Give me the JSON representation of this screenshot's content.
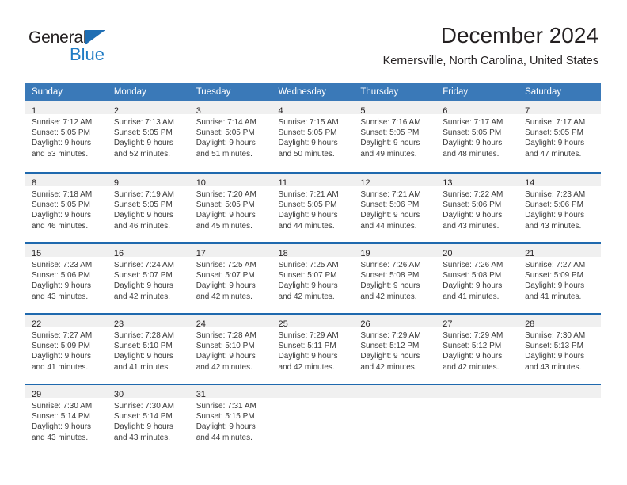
{
  "brand": {
    "name_part1": "General",
    "name_part2": "Blue",
    "triangle_icon": "triangle-icon"
  },
  "header": {
    "title": "December 2024",
    "subtitle": "Kernersville, North Carolina, United States"
  },
  "calendar": {
    "weekday_headers": [
      "Sunday",
      "Monday",
      "Tuesday",
      "Wednesday",
      "Thursday",
      "Friday",
      "Saturday"
    ],
    "colors": {
      "header_background": "#3a79b8",
      "header_text": "#ffffff",
      "row_separator": "#1f69ae",
      "daynum_strip": "#f0f0f0",
      "brand_blue": "#1f7bc4"
    },
    "weeks": [
      [
        {
          "day": "1",
          "sunrise": "Sunrise: 7:12 AM",
          "sunset": "Sunset: 5:05 PM",
          "daylight1": "Daylight: 9 hours",
          "daylight2": "and 53 minutes."
        },
        {
          "day": "2",
          "sunrise": "Sunrise: 7:13 AM",
          "sunset": "Sunset: 5:05 PM",
          "daylight1": "Daylight: 9 hours",
          "daylight2": "and 52 minutes."
        },
        {
          "day": "3",
          "sunrise": "Sunrise: 7:14 AM",
          "sunset": "Sunset: 5:05 PM",
          "daylight1": "Daylight: 9 hours",
          "daylight2": "and 51 minutes."
        },
        {
          "day": "4",
          "sunrise": "Sunrise: 7:15 AM",
          "sunset": "Sunset: 5:05 PM",
          "daylight1": "Daylight: 9 hours",
          "daylight2": "and 50 minutes."
        },
        {
          "day": "5",
          "sunrise": "Sunrise: 7:16 AM",
          "sunset": "Sunset: 5:05 PM",
          "daylight1": "Daylight: 9 hours",
          "daylight2": "and 49 minutes."
        },
        {
          "day": "6",
          "sunrise": "Sunrise: 7:17 AM",
          "sunset": "Sunset: 5:05 PM",
          "daylight1": "Daylight: 9 hours",
          "daylight2": "and 48 minutes."
        },
        {
          "day": "7",
          "sunrise": "Sunrise: 7:17 AM",
          "sunset": "Sunset: 5:05 PM",
          "daylight1": "Daylight: 9 hours",
          "daylight2": "and 47 minutes."
        }
      ],
      [
        {
          "day": "8",
          "sunrise": "Sunrise: 7:18 AM",
          "sunset": "Sunset: 5:05 PM",
          "daylight1": "Daylight: 9 hours",
          "daylight2": "and 46 minutes."
        },
        {
          "day": "9",
          "sunrise": "Sunrise: 7:19 AM",
          "sunset": "Sunset: 5:05 PM",
          "daylight1": "Daylight: 9 hours",
          "daylight2": "and 46 minutes."
        },
        {
          "day": "10",
          "sunrise": "Sunrise: 7:20 AM",
          "sunset": "Sunset: 5:05 PM",
          "daylight1": "Daylight: 9 hours",
          "daylight2": "and 45 minutes."
        },
        {
          "day": "11",
          "sunrise": "Sunrise: 7:21 AM",
          "sunset": "Sunset: 5:05 PM",
          "daylight1": "Daylight: 9 hours",
          "daylight2": "and 44 minutes."
        },
        {
          "day": "12",
          "sunrise": "Sunrise: 7:21 AM",
          "sunset": "Sunset: 5:06 PM",
          "daylight1": "Daylight: 9 hours",
          "daylight2": "and 44 minutes."
        },
        {
          "day": "13",
          "sunrise": "Sunrise: 7:22 AM",
          "sunset": "Sunset: 5:06 PM",
          "daylight1": "Daylight: 9 hours",
          "daylight2": "and 43 minutes."
        },
        {
          "day": "14",
          "sunrise": "Sunrise: 7:23 AM",
          "sunset": "Sunset: 5:06 PM",
          "daylight1": "Daylight: 9 hours",
          "daylight2": "and 43 minutes."
        }
      ],
      [
        {
          "day": "15",
          "sunrise": "Sunrise: 7:23 AM",
          "sunset": "Sunset: 5:06 PM",
          "daylight1": "Daylight: 9 hours",
          "daylight2": "and 43 minutes."
        },
        {
          "day": "16",
          "sunrise": "Sunrise: 7:24 AM",
          "sunset": "Sunset: 5:07 PM",
          "daylight1": "Daylight: 9 hours",
          "daylight2": "and 42 minutes."
        },
        {
          "day": "17",
          "sunrise": "Sunrise: 7:25 AM",
          "sunset": "Sunset: 5:07 PM",
          "daylight1": "Daylight: 9 hours",
          "daylight2": "and 42 minutes."
        },
        {
          "day": "18",
          "sunrise": "Sunrise: 7:25 AM",
          "sunset": "Sunset: 5:07 PM",
          "daylight1": "Daylight: 9 hours",
          "daylight2": "and 42 minutes."
        },
        {
          "day": "19",
          "sunrise": "Sunrise: 7:26 AM",
          "sunset": "Sunset: 5:08 PM",
          "daylight1": "Daylight: 9 hours",
          "daylight2": "and 42 minutes."
        },
        {
          "day": "20",
          "sunrise": "Sunrise: 7:26 AM",
          "sunset": "Sunset: 5:08 PM",
          "daylight1": "Daylight: 9 hours",
          "daylight2": "and 41 minutes."
        },
        {
          "day": "21",
          "sunrise": "Sunrise: 7:27 AM",
          "sunset": "Sunset: 5:09 PM",
          "daylight1": "Daylight: 9 hours",
          "daylight2": "and 41 minutes."
        }
      ],
      [
        {
          "day": "22",
          "sunrise": "Sunrise: 7:27 AM",
          "sunset": "Sunset: 5:09 PM",
          "daylight1": "Daylight: 9 hours",
          "daylight2": "and 41 minutes."
        },
        {
          "day": "23",
          "sunrise": "Sunrise: 7:28 AM",
          "sunset": "Sunset: 5:10 PM",
          "daylight1": "Daylight: 9 hours",
          "daylight2": "and 41 minutes."
        },
        {
          "day": "24",
          "sunrise": "Sunrise: 7:28 AM",
          "sunset": "Sunset: 5:10 PM",
          "daylight1": "Daylight: 9 hours",
          "daylight2": "and 42 minutes."
        },
        {
          "day": "25",
          "sunrise": "Sunrise: 7:29 AM",
          "sunset": "Sunset: 5:11 PM",
          "daylight1": "Daylight: 9 hours",
          "daylight2": "and 42 minutes."
        },
        {
          "day": "26",
          "sunrise": "Sunrise: 7:29 AM",
          "sunset": "Sunset: 5:12 PM",
          "daylight1": "Daylight: 9 hours",
          "daylight2": "and 42 minutes."
        },
        {
          "day": "27",
          "sunrise": "Sunrise: 7:29 AM",
          "sunset": "Sunset: 5:12 PM",
          "daylight1": "Daylight: 9 hours",
          "daylight2": "and 42 minutes."
        },
        {
          "day": "28",
          "sunrise": "Sunrise: 7:30 AM",
          "sunset": "Sunset: 5:13 PM",
          "daylight1": "Daylight: 9 hours",
          "daylight2": "and 43 minutes."
        }
      ],
      [
        {
          "day": "29",
          "sunrise": "Sunrise: 7:30 AM",
          "sunset": "Sunset: 5:14 PM",
          "daylight1": "Daylight: 9 hours",
          "daylight2": "and 43 minutes."
        },
        {
          "day": "30",
          "sunrise": "Sunrise: 7:30 AM",
          "sunset": "Sunset: 5:14 PM",
          "daylight1": "Daylight: 9 hours",
          "daylight2": "and 43 minutes."
        },
        {
          "day": "31",
          "sunrise": "Sunrise: 7:31 AM",
          "sunset": "Sunset: 5:15 PM",
          "daylight1": "Daylight: 9 hours",
          "daylight2": "and 44 minutes."
        },
        {
          "day": "",
          "sunrise": "",
          "sunset": "",
          "daylight1": "",
          "daylight2": ""
        },
        {
          "day": "",
          "sunrise": "",
          "sunset": "",
          "daylight1": "",
          "daylight2": ""
        },
        {
          "day": "",
          "sunrise": "",
          "sunset": "",
          "daylight1": "",
          "daylight2": ""
        },
        {
          "day": "",
          "sunrise": "",
          "sunset": "",
          "daylight1": "",
          "daylight2": ""
        }
      ]
    ]
  }
}
